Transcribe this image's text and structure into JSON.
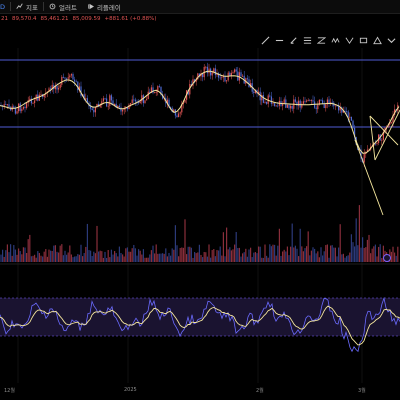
{
  "toolbar": {
    "symbol_fragment": "D",
    "items": [
      {
        "label": "지표",
        "icon": "indicator-icon"
      },
      {
        "label": "얼러트",
        "icon": "alert-icon"
      },
      {
        "label": "리플레이",
        "icon": "replay-icon"
      }
    ]
  },
  "price_row": {
    "prefix": "21",
    "open": "89,570.4",
    "high": "85,461.21",
    "low": "85,009.59",
    "change": "+881.61 (+0.88%)"
  },
  "x_axis": {
    "labels": [
      "12월",
      "2025",
      "2월",
      "3월"
    ]
  },
  "colors": {
    "background": "#000000",
    "channel_line": "#4f5bd5",
    "ma_line": "#f5e79e",
    "candle_up": "#e15554",
    "candle_down": "#4e6bd5",
    "oscillator_band": "#7b61ff",
    "oscillator_fill": "#1a1330"
  },
  "drawing_tools": [
    "trend-line-icon",
    "horizontal-line-icon",
    "vertical-line-icon",
    "fib-icon",
    "pattern-icon",
    "wave-icon",
    "rectangle-icon",
    "triangle-icon",
    "collapse-icon"
  ]
}
